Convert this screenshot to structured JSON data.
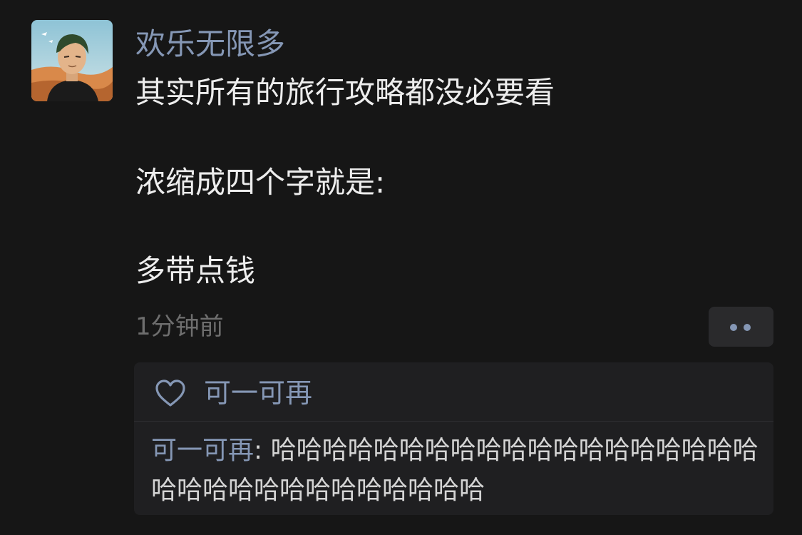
{
  "post": {
    "username": "欢乐无限多",
    "content_lines": [
      "其实所有的旅行攻略都没必要看",
      "浓缩成四个字就是:",
      "多带点钱"
    ],
    "timestamp": "1分钟前"
  },
  "more_button": {
    "icon": "more-dots-icon"
  },
  "likes": {
    "icon": "heart-icon",
    "users": [
      "可一可再"
    ]
  },
  "comments": [
    {
      "author": "可一可再",
      "separator": ": ",
      "text": "哈哈哈哈哈哈哈哈哈哈哈哈哈哈哈哈哈哈哈哈哈哈哈哈哈哈哈哈哈哈哈哈"
    }
  ],
  "colors": {
    "background": "#161616",
    "accent_name": "#8597b5",
    "text_primary": "#ededed",
    "text_muted": "#6e6e6e",
    "panel": "#1f1f21"
  }
}
